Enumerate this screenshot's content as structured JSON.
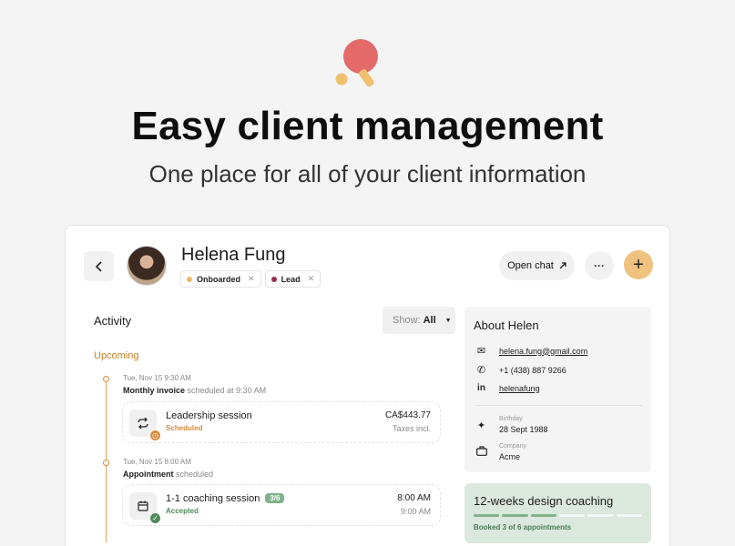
{
  "hero": {
    "title": "Easy client management",
    "subtitle": "One place for all of your client information"
  },
  "client": {
    "name": "Helena Fung",
    "tags": [
      {
        "label": "Onboarded",
        "color": "#f0b96a"
      },
      {
        "label": "Lead",
        "color": "#9b2d4a"
      }
    ]
  },
  "header": {
    "open_chat": "Open chat",
    "more": "···",
    "add": "+"
  },
  "activity": {
    "title": "Activity",
    "show_label": "Show:",
    "show_value": "All",
    "section": "Upcoming",
    "events": [
      {
        "time": "Tue, Nov 15 9:30 AM",
        "title_bold": "Monthly invoice",
        "title_rest": " scheduled at 9:30 AM",
        "name": "Leadership session",
        "status": "Scheduled",
        "status_color": "#d98b3a",
        "right_top": "CA$443.77",
        "right_bottom": "Taxes incl.",
        "icon": "repeat-icon",
        "badge_icon": "clock-icon"
      },
      {
        "time": "Tue, Nov 15 8:00 AM",
        "title_bold": "Appointment",
        "title_rest": " scheduled",
        "name": "1-1 coaching session",
        "pill": "3/6",
        "status": "Accepted",
        "status_color": "#4e8a5c",
        "right_top": "8:00 AM",
        "right_bottom": "9:00 AM",
        "icon": "calendar-icon",
        "badge_icon": "check-icon"
      }
    ]
  },
  "about": {
    "title": "About Helen",
    "email": "helena.fung@gmail.com",
    "phone": "+1 (438) 887 9266",
    "linkedin": "helenafung",
    "birthday_label": "Birthday",
    "birthday": "28 Sept 1988",
    "company_label": "Company",
    "company": "Acme"
  },
  "coaching": {
    "title": "12-weeks design coaching",
    "subtitle": "Booked 3 of 6 appointments",
    "booked": 3,
    "total": 6,
    "fill_color": "#7fb38a",
    "empty_color": "#f4f7f4"
  },
  "colors": {
    "accent": "#efc27e",
    "timeline": "#d98b3a"
  }
}
